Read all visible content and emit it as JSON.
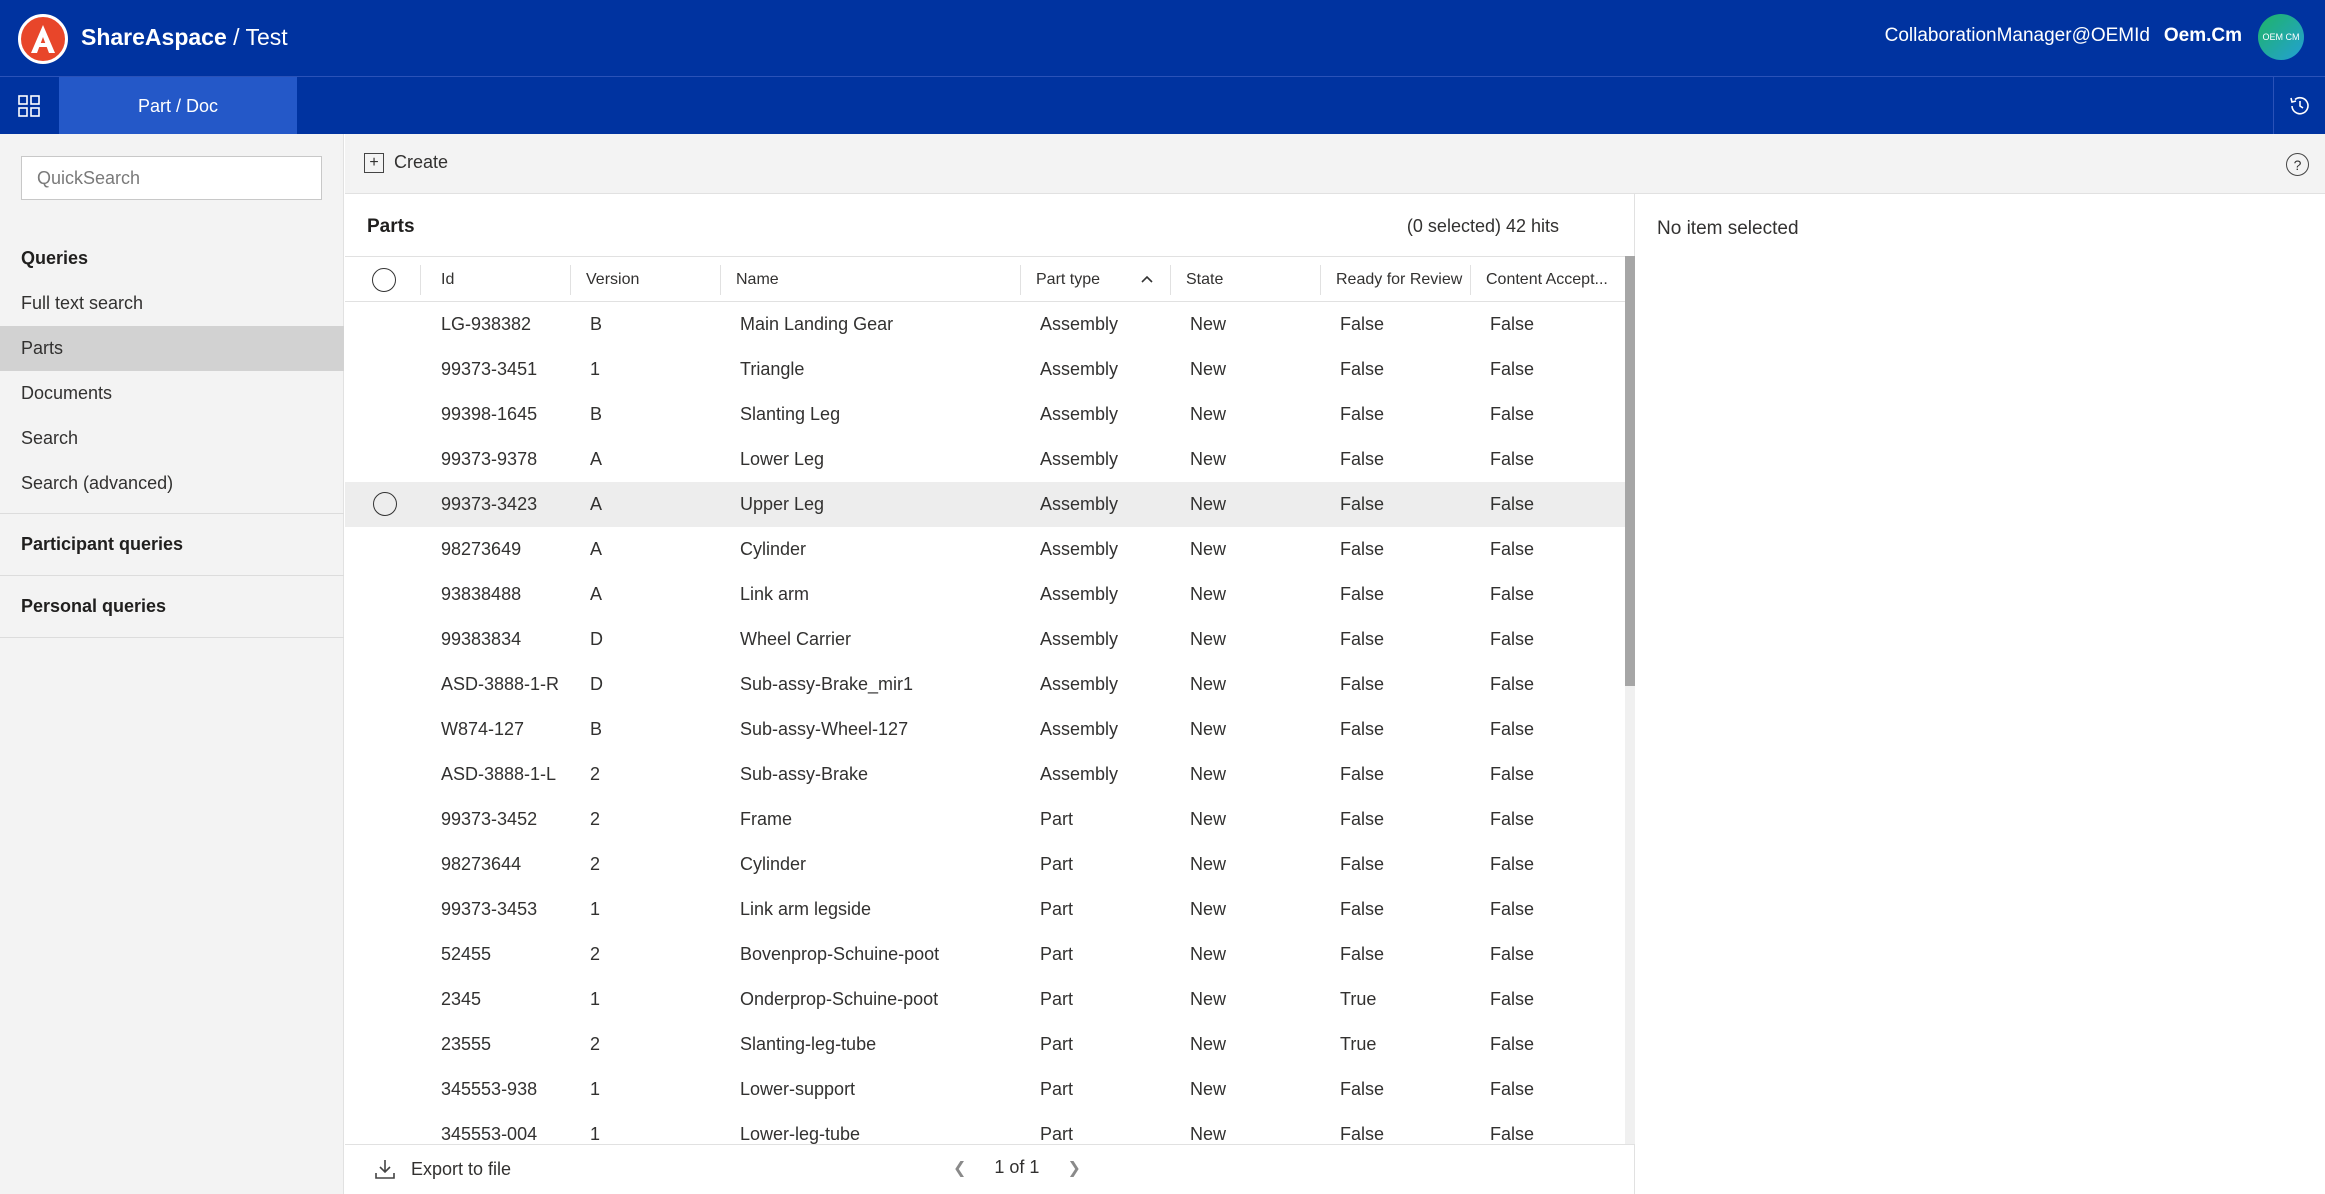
{
  "header": {
    "brand_bold": "ShareAspace",
    "brand_rest": " / Test",
    "user_email": "CollaborationManager@OEMId",
    "user_short": "Oem.Cm",
    "avatar_initials": "OEM CM",
    "accent_color": "#0033a0"
  },
  "nav": {
    "tab_label": "Part / Doc"
  },
  "sidebar": {
    "search_placeholder": "QuickSearch",
    "queries_heading": "Queries",
    "items": [
      {
        "label": "Full text search"
      },
      {
        "label": "Parts"
      },
      {
        "label": "Documents"
      },
      {
        "label": "Search"
      },
      {
        "label": "Search (advanced)"
      }
    ],
    "participant_heading": "Participant queries",
    "personal_heading": "Personal queries"
  },
  "toolbar": {
    "create_label": "Create",
    "help_label": "?"
  },
  "parts": {
    "title": "Parts",
    "hits": "(0 selected) 42 hits",
    "columns": [
      "Id",
      "Version",
      "Name",
      "Part type",
      "State",
      "Ready for Review",
      "Content Accept..."
    ],
    "rows": [
      [
        "LG-938382",
        "B",
        "Main Landing Gear",
        "Assembly",
        "New",
        "False",
        "False"
      ],
      [
        "99373-3451",
        "1",
        "Triangle",
        "Assembly",
        "New",
        "False",
        "False"
      ],
      [
        "99398-1645",
        "B",
        "Slanting Leg",
        "Assembly",
        "New",
        "False",
        "False"
      ],
      [
        "99373-9378",
        "A",
        "Lower Leg",
        "Assembly",
        "New",
        "False",
        "False"
      ],
      [
        "99373-3423",
        "A",
        "Upper Leg",
        "Assembly",
        "New",
        "False",
        "False"
      ],
      [
        "98273649",
        "A",
        "Cylinder",
        "Assembly",
        "New",
        "False",
        "False"
      ],
      [
        "93838488",
        "A",
        "Link arm",
        "Assembly",
        "New",
        "False",
        "False"
      ],
      [
        "99383834",
        "D",
        "Wheel Carrier",
        "Assembly",
        "New",
        "False",
        "False"
      ],
      [
        "ASD-3888-1-R",
        "D",
        "Sub-assy-Brake_mir1",
        "Assembly",
        "New",
        "False",
        "False"
      ],
      [
        "W874-127",
        "B",
        "Sub-assy-Wheel-127",
        "Assembly",
        "New",
        "False",
        "False"
      ],
      [
        "ASD-3888-1-L",
        "2",
        "Sub-assy-Brake",
        "Assembly",
        "New",
        "False",
        "False"
      ],
      [
        "99373-3452",
        "2",
        "Frame",
        "Part",
        "New",
        "False",
        "False"
      ],
      [
        "98273644",
        "2",
        "Cylinder",
        "Part",
        "New",
        "False",
        "False"
      ],
      [
        "99373-3453",
        "1",
        "Link arm legside",
        "Part",
        "New",
        "False",
        "False"
      ],
      [
        "52455",
        "2",
        "Bovenprop-Schuine-poot",
        "Part",
        "New",
        "False",
        "False"
      ],
      [
        "2345",
        "1",
        "Onderprop-Schuine-poot",
        "Part",
        "New",
        "True",
        "False"
      ],
      [
        "23555",
        "2",
        "Slanting-leg-tube",
        "Part",
        "New",
        "True",
        "False"
      ],
      [
        "345553-938",
        "1",
        "Lower-support",
        "Part",
        "New",
        "False",
        "False"
      ],
      [
        "345553-004",
        "1",
        "Lower-leg-tube",
        "Part",
        "New",
        "False",
        "False"
      ]
    ],
    "export_label": "Export to file",
    "pager_label": "1 of 1"
  },
  "detail": {
    "empty_text": "No item selected"
  }
}
